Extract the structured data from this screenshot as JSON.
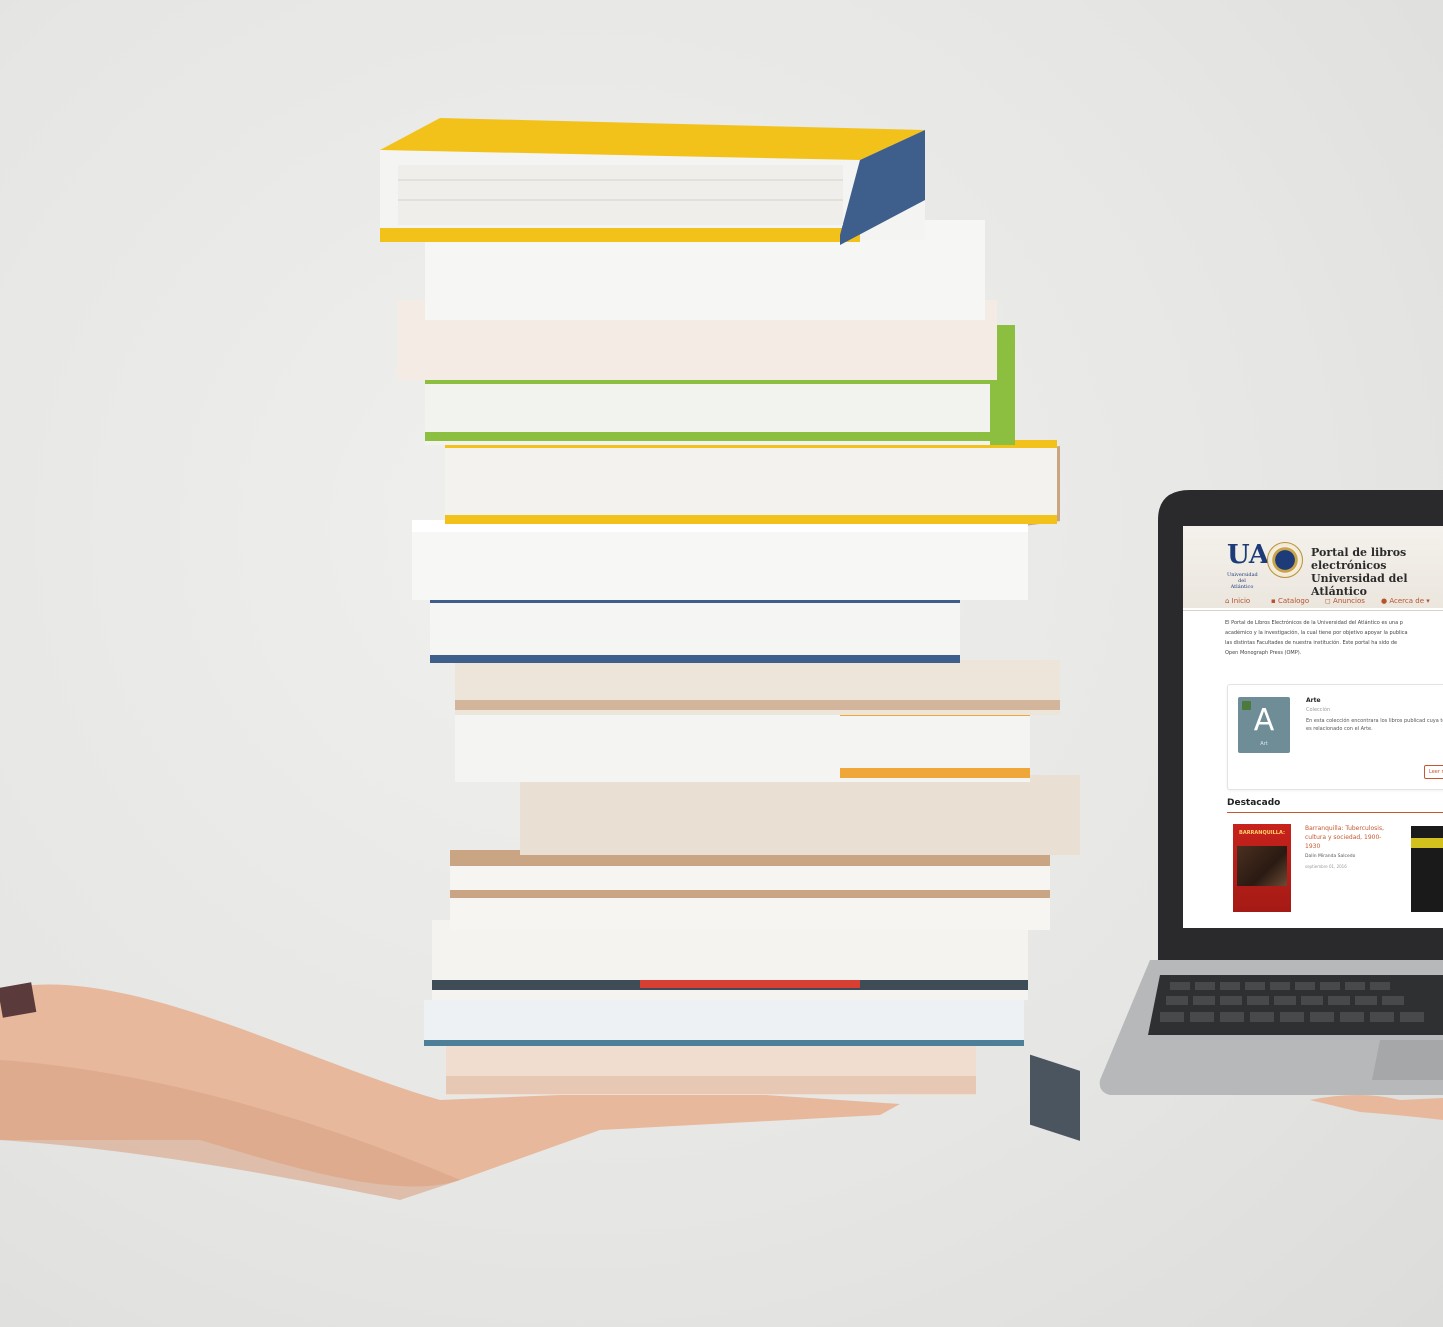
{
  "portal": {
    "title_line1": "Portal de libros electrónicos",
    "title_line2": "Universidad del Atlántico",
    "logo_letters": "UA",
    "logo_caption": "Universidad del Atlántico"
  },
  "nav": {
    "inicio": "Inicio",
    "catalogo": "Catalogo",
    "anuncios": "Anuncios",
    "acerca": "Acerca de ▾"
  },
  "intro": {
    "line1": "El Portal de Libros Electrónicos de la Universidad del Atlántico es una p",
    "line2": "académico y la investigación, la cual tiene por objetivo apoyar la publica",
    "line3": "las distintas Facultades de nuestra institución. Este portal ha sido de",
    "line4": "Open Monograph Press (OMP)."
  },
  "collection_card": {
    "thumb_letter": "A",
    "thumb_caption": "Art",
    "title": "Arte",
    "subtitle": "Colección",
    "description": "En esta colección encontrara los libros publicad cuya tematica es relacionado con el Arte.",
    "read_more": "Leer r"
  },
  "featured": {
    "heading": "Destacado",
    "book_cover_title": "BARRANQUILLA:",
    "book_title": "Barranquilla: Tuberculosis, cultura y sociedad, 1900-1930",
    "book_author": "Dalín Miranda Salcedo",
    "book_date": "septiembre 01, 2016"
  },
  "colors": {
    "accent": "#c5582e",
    "book_yellow": "#f2c21b",
    "book_green": "#8cbf3f",
    "book_blue": "#3e5f8c"
  }
}
